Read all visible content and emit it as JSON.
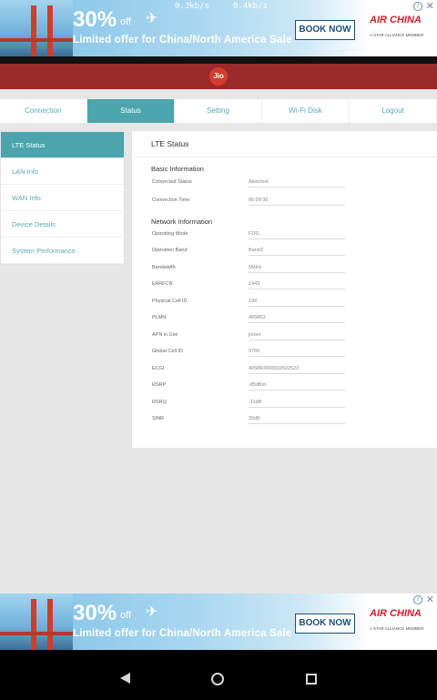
{
  "status_bar": {
    "download_speed": "0.3kb/s",
    "upload_speed": "0.4kb/s"
  },
  "ad_top": {
    "discount": "30%",
    "off": "off",
    "offer": "Limited offer for China/North America Sale",
    "button": "BOOK NOW",
    "brand": "AIR CHINA",
    "brand_sub": "A STAR ALLIANCE MEMBER"
  },
  "ad_bottom": {
    "discount": "30%",
    "off": "off",
    "offer": "Limited offer for China/North America Sale",
    "button": "BOOK NOW",
    "brand": "AIR CHINA",
    "brand_sub": "A STAR ALLIANCE MEMBER"
  },
  "header": {
    "logo": "Jio"
  },
  "nav": {
    "tabs": [
      {
        "label": "Connection"
      },
      {
        "label": "Status"
      },
      {
        "label": "Setting"
      },
      {
        "label": "Wi-Fi Disk"
      },
      {
        "label": "Logout"
      }
    ]
  },
  "sidebar": {
    "items": [
      {
        "label": "LTE Status"
      },
      {
        "label": "LAN Info"
      },
      {
        "label": "WAN Info"
      },
      {
        "label": "Device Details"
      },
      {
        "label": "System Performance"
      }
    ]
  },
  "lte": {
    "title": "LTE Status",
    "basic_title": "Basic Information",
    "basic": [
      {
        "label": "Connected Status",
        "value": "Attached"
      },
      {
        "label": "Connection Time",
        "value": "06:09:36"
      }
    ],
    "network_title": "Network Information",
    "network": [
      {
        "label": "Operating Mode",
        "value": "FDD"
      },
      {
        "label": "Operation Band",
        "value": "Band3"
      },
      {
        "label": "Bandwidth",
        "value": "5MHz"
      },
      {
        "label": "EARFCN",
        "value": "1443"
      },
      {
        "label": "Physical Cell ID",
        "value": "198"
      },
      {
        "label": "PLMN",
        "value": "405863"
      },
      {
        "label": "APN in Use",
        "value": "jionet"
      },
      {
        "label": "Global Cell ID",
        "value": "9765"
      },
      {
        "label": "ECGI",
        "value": "405860000002502523"
      },
      {
        "label": "RSRP",
        "value": "-85dBm"
      },
      {
        "label": "RSRQ",
        "value": "-11dB"
      },
      {
        "label": "SINR",
        "value": "30dB"
      }
    ]
  }
}
